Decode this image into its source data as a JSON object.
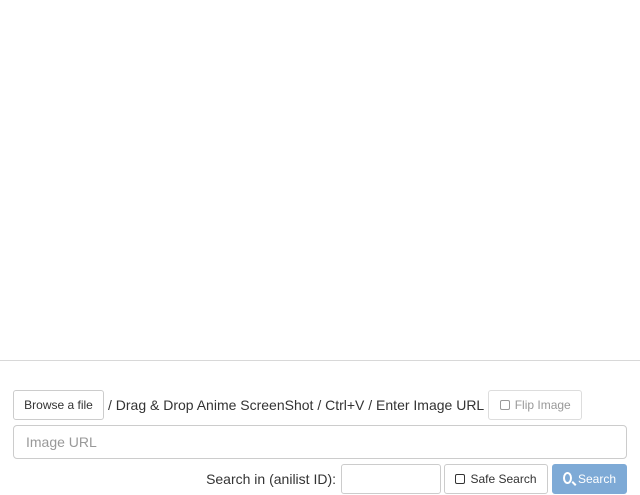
{
  "upload": {
    "browse_label": "Browse a file",
    "instructions": "/ Drag & Drop Anime ScreenShot / Ctrl+V / Enter Image URL",
    "flip_label": "Flip Image"
  },
  "url_field": {
    "placeholder": "Image URL",
    "value": ""
  },
  "search_options": {
    "anilist_label": "Search in (anilist ID):",
    "anilist_value": "",
    "safe_search_label": "Safe Search",
    "safe_search_checked": false,
    "search_label": "Search"
  },
  "colors": {
    "search_button": "#7eaad6",
    "border": "#cccccc",
    "text": "#333333",
    "muted": "#999999"
  },
  "icons": {
    "flip_checkbox": "checkbox-unchecked-icon",
    "safe_checkbox": "checkbox-unchecked-icon",
    "search": "search-icon"
  }
}
